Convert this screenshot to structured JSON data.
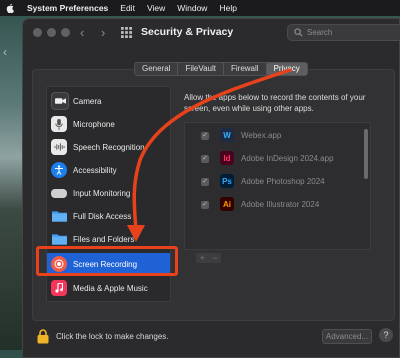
{
  "menubar": {
    "items": [
      "System Preferences",
      "Edit",
      "View",
      "Window",
      "Help"
    ]
  },
  "window": {
    "title": "Security & Privacy",
    "search_placeholder": "Search"
  },
  "tabs": [
    {
      "label": "General",
      "active": false
    },
    {
      "label": "FileVault",
      "active": false
    },
    {
      "label": "Firewall",
      "active": false
    },
    {
      "label": "Privacy",
      "active": true
    }
  ],
  "sidebar": {
    "items": [
      {
        "label": "Camera",
        "icon": "camera-icon",
        "color": "#3a3a3c"
      },
      {
        "label": "Microphone",
        "icon": "microphone-icon",
        "color": "#e9e9e9"
      },
      {
        "label": "Speech Recognition",
        "icon": "speech-recognition-icon",
        "color": "#e9e9e9"
      },
      {
        "label": "Accessibility",
        "icon": "accessibility-icon",
        "color": "#1b7ff0"
      },
      {
        "label": "Input Monitoring",
        "icon": "keyboard-icon",
        "color": "#d0d0d0"
      },
      {
        "label": "Full Disk Access",
        "icon": "folder-icon",
        "color": "#3e9bf0"
      },
      {
        "label": "Files and Folders",
        "icon": "folder-icon",
        "color": "#3e9bf0"
      },
      {
        "label": "Screen Recording",
        "icon": "screen-recording-icon",
        "color": "#f25a4a",
        "selected": true
      },
      {
        "label": "Media & Apple Music",
        "icon": "music-icon",
        "color": "#f5365c"
      }
    ]
  },
  "description": "Allow the apps below to record the contents of your screen, even while using other apps.",
  "apps": [
    {
      "name": "Webex.app",
      "icon_text": "W",
      "icon_color": "#1e2a44",
      "text_color": "#34b3ff"
    },
    {
      "name": "Adobe InDesign 2024.app",
      "icon_text": "Id",
      "icon_color": "#49021f",
      "text_color": "#ff3366"
    },
    {
      "name": "Adobe Photoshop 2024",
      "icon_text": "Ps",
      "icon_color": "#001e36",
      "text_color": "#31a8ff"
    },
    {
      "name": "Adobe Illustrator 2024",
      "icon_text": "Ai",
      "icon_color": "#330000",
      "text_color": "#ff9a00"
    }
  ],
  "list_buttons": {
    "add": "+",
    "remove": "−"
  },
  "footer": {
    "lock_text": "Click the lock to make changes.",
    "advanced_label": "Advanced...",
    "help_label": "?"
  },
  "colors": {
    "selection": "#1f62d6",
    "annotation": "#e8421d"
  }
}
